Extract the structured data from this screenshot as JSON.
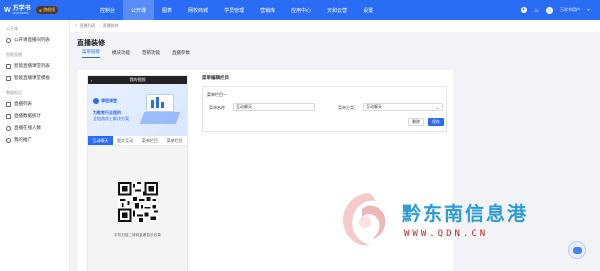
{
  "topbar": {
    "logo_mark": "W",
    "logo_name": "万学书",
    "logo_sub": "WANXUESHU",
    "edition": "旗舰版",
    "nav": [
      "控制台",
      "公开课",
      "图表",
      "网校商城",
      "学员管理",
      "营销库",
      "应用中心",
      "天和云营",
      "设置"
    ],
    "active_nav_index": 1,
    "user_name": "万学书用户"
  },
  "sidebar": {
    "sections": [
      {
        "title": "公开课",
        "items": [
          "公开课直播间列表"
        ]
      },
      {
        "title": "智能直播",
        "items": [
          "智能直播课堂列表",
          "智能直播课堂模板"
        ]
      },
      {
        "title": "数据报告",
        "items": [
          "直播列表",
          "直播数据统计",
          "直播在线人数",
          "我的推广"
        ]
      }
    ]
  },
  "breadcrumb": [
    "直播列表",
    "直播装修"
  ],
  "page_title": "直播装修",
  "tabs": [
    "菜单链接",
    "模块功能",
    "营销功能",
    "直播参数"
  ],
  "active_tab_index": 0,
  "preview": {
    "header": "我的视频",
    "banner_brand": "课程课堂",
    "banner_line1": "为教育行业提供",
    "banner_line2": "全链路线上解决方案",
    "tabs": [
      "互动聊天",
      "图文互动",
      "菜单栏目",
      "菜单栏目"
    ],
    "active_tab_index": 0,
    "qr_caption": "手机扫描二维码查看显示效果"
  },
  "form": {
    "section_title": "菜单编辑栏目",
    "card_head": "菜单栏目一",
    "name_label": "菜单名称",
    "name_value": "互动聊天",
    "type_label": "菜单分类",
    "type_value": "互动聊天",
    "cancel_label": "删除",
    "save_label": "保存"
  },
  "watermark": {
    "title": "黔东南信息港",
    "url": "WWW.QDN.CN"
  },
  "colors": {
    "primary": "#2b6cf5",
    "watermark_blue": "#2a9bd8",
    "watermark_red": "#c72424"
  }
}
